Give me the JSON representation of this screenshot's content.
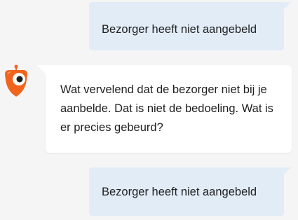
{
  "conversation": {
    "messages": [
      {
        "sender": "user",
        "text": "Bezorger heeft niet aangebeld"
      },
      {
        "sender": "bot",
        "text": "Wat vervelend dat de bezorger niet bij je aanbelde. Dat is niet de bedoeling. Wat is er precies gebeurd?"
      },
      {
        "sender": "user",
        "text": "Bezorger heeft niet aangebeld"
      }
    ]
  },
  "bot_avatar": {
    "icon": "robot-mascot-icon",
    "colors": {
      "body": "#f0641e",
      "eye": "#ffffff",
      "pupil": "#1f1f1f"
    }
  },
  "colors": {
    "background": "#f5f5f5",
    "user_bubble": "#e1ecf7",
    "bot_bubble": "#ffffff",
    "text": "#1f1f1f"
  }
}
